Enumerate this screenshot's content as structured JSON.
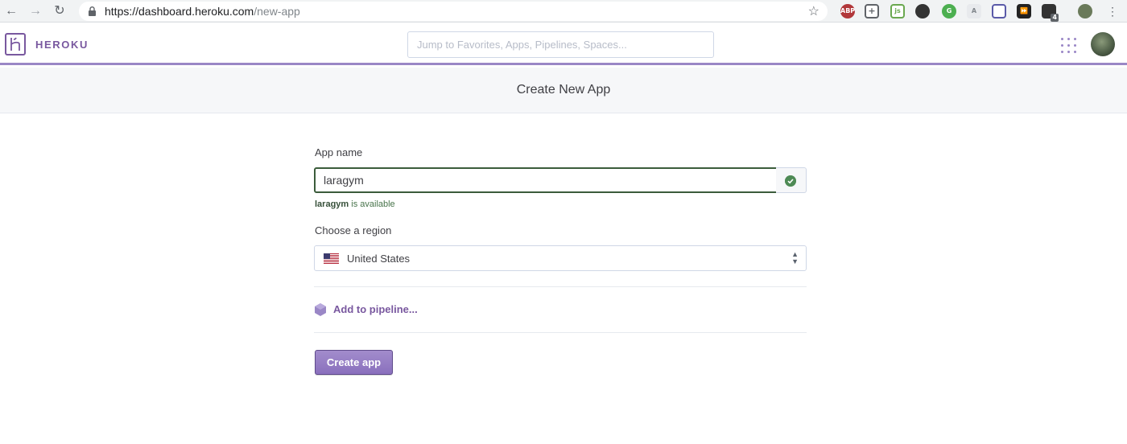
{
  "browser": {
    "url_host": "https://dashboard.heroku.com",
    "url_path": "/new-app",
    "extension_badge": "4"
  },
  "header": {
    "brand": "HEROKU",
    "search_placeholder": "Jump to Favorites, Apps, Pipelines, Spaces..."
  },
  "page": {
    "title": "Create New App"
  },
  "form": {
    "app_name_label": "App name",
    "app_name_value": "laragym",
    "availability_name": "laragym",
    "availability_text": " is available",
    "region_label": "Choose a region",
    "region_value": "United States",
    "pipeline_link": "Add to pipeline...",
    "create_button": "Create app"
  },
  "colors": {
    "brand": "#79589f",
    "valid": "#4e8a55"
  }
}
